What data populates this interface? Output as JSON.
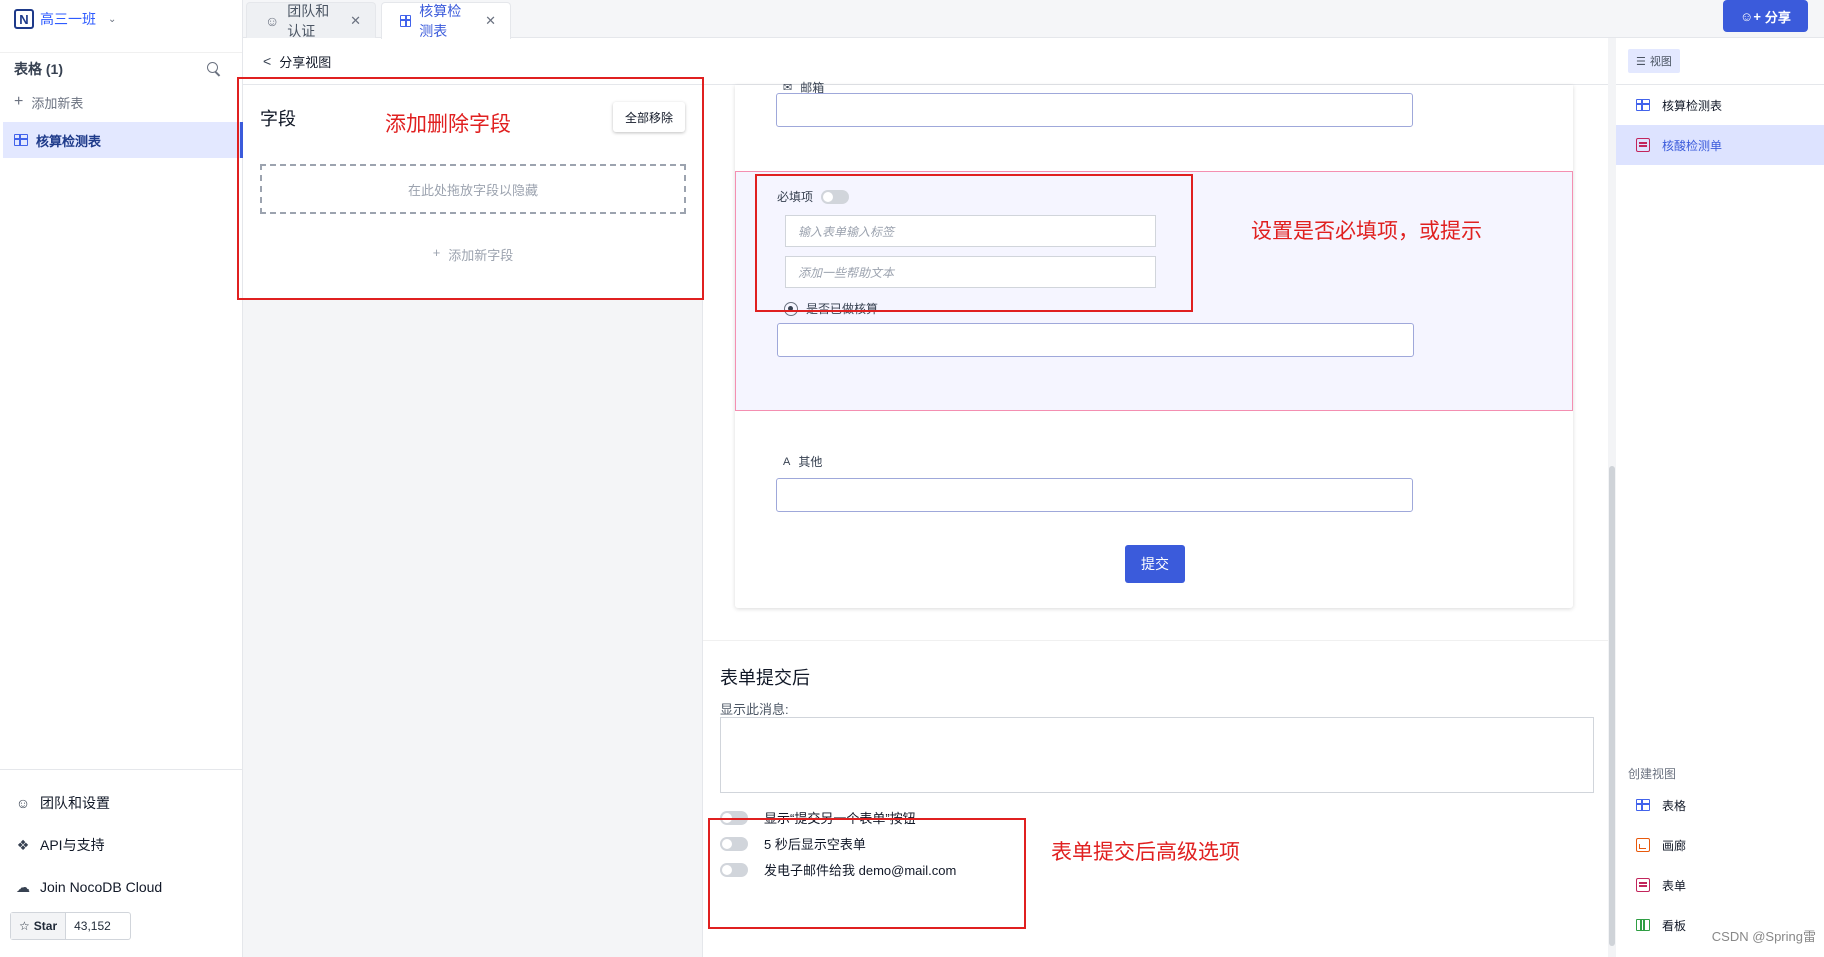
{
  "project": {
    "logo": "N",
    "name": "高三一班"
  },
  "sidebar": {
    "tables_header": "表格 (1)",
    "add_table": "添加新表",
    "tables": [
      {
        "label": "核算检测表"
      }
    ],
    "bottom_links": [
      {
        "label": "团队和设置",
        "icon": "team-icon"
      },
      {
        "label": "API与支持",
        "icon": "api-icon"
      },
      {
        "label": "Join NocoDB Cloud",
        "icon": "cloud-icon"
      }
    ],
    "star": {
      "label": "Star",
      "count": "43,152"
    }
  },
  "tabs": [
    {
      "label": "团队和认证",
      "icon": "team-icon"
    },
    {
      "label": "核算检测表",
      "icon": "grid-icon",
      "active": true
    }
  ],
  "share_button": "分享",
  "toolbar": {
    "share_view": "分享视图"
  },
  "fields_panel": {
    "title": "字段",
    "remove_all": "全部移除",
    "drop_hint": "在此处拖放字段以隐藏",
    "add_field": "添加新字段"
  },
  "form": {
    "fields": [
      {
        "label": "邮箱",
        "icon": "email-icon"
      },
      {
        "label": "是否已做核算",
        "icon": "radio-icon",
        "active": true
      },
      {
        "label": "其他",
        "icon": "text-icon"
      }
    ],
    "required_label": "必填项",
    "label_placeholder": "输入表单输入标签",
    "help_placeholder": "添加一些帮助文本",
    "submit": "提交"
  },
  "after_submit": {
    "title": "表单提交后",
    "show_message": "显示此消息:",
    "options": [
      {
        "label": "显示“提交另一个表单”按钮",
        "enabled": false
      },
      {
        "label": "5 秒后显示空表单",
        "enabled": false
      },
      {
        "label": "发电子邮件给我 demo@mail.com",
        "enabled": false
      }
    ]
  },
  "annotations": {
    "fields": "添加删除字段",
    "required": "设置是否必填项，或提示",
    "advanced": "表单提交后高级选项"
  },
  "views_panel": {
    "tag": "视图",
    "views": [
      {
        "label": "核算检测表",
        "icon": "grid-icon"
      },
      {
        "label": "核酸检测单",
        "icon": "form-icon",
        "active": true
      }
    ],
    "create_label": "创建视图",
    "create_options": [
      {
        "label": "表格",
        "icon": "grid-icon"
      },
      {
        "label": "画廊",
        "icon": "gallery-icon"
      },
      {
        "label": "表单",
        "icon": "form-icon"
      },
      {
        "label": "看板",
        "icon": "kanban-icon"
      }
    ]
  },
  "watermark": "CSDN @Spring雷"
}
